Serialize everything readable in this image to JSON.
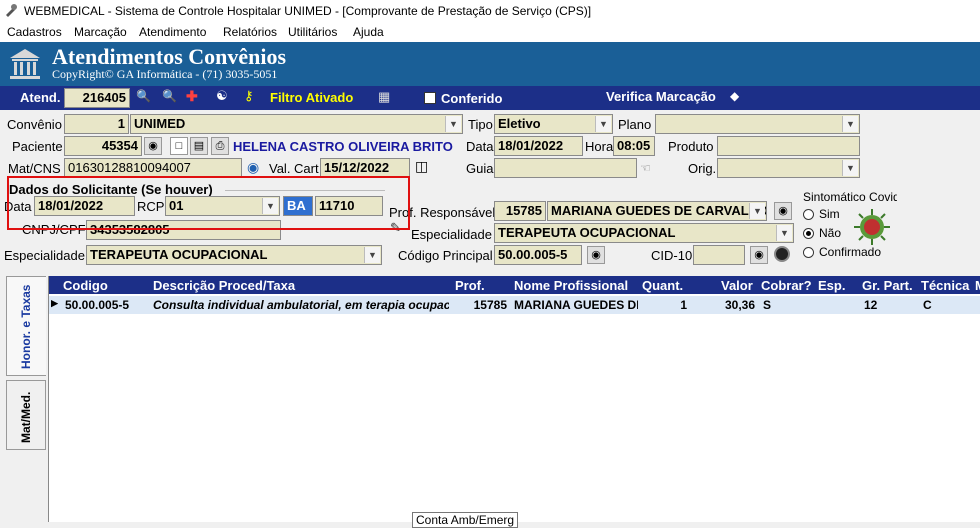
{
  "window": {
    "title": "WEBMEDICAL - Sistema de Controle Hospitalar UNIMED - [Comprovante de Prestação de Serviço  (CPS)]"
  },
  "menu": [
    "Cadastros",
    "Marcação",
    "Atendimento",
    "Relatórios",
    "Utilitários",
    "Ajuda"
  ],
  "banner": {
    "title": "Atendimentos Convênios",
    "subtitle": "CopyRight© GA Informática - (71) 3035-5051"
  },
  "toolbar": {
    "atend_label": "Atend.",
    "atend_value": "216405",
    "filtro_label": "Filtro Ativado",
    "conferido_label": "Conferido",
    "verifica_label": "Verifica Marcação"
  },
  "form": {
    "convenio_label": "Convênio",
    "convenio_code": "1",
    "convenio_name": "UNIMED",
    "tipo_label": "Tipo",
    "tipo_value": "Eletivo",
    "plano_label": "Plano",
    "plano_value": "",
    "paciente_label": "Paciente",
    "paciente_code": "45354",
    "paciente_name": "HELENA CASTRO OLIVEIRA BRITO",
    "data_label": "Data",
    "data_value": "18/01/2022",
    "hora_label": "Hora",
    "hora_value": "08:05",
    "produto_label": "Produto",
    "produto_value": "",
    "matcns_label": "Mat/CNS",
    "matcns_value": "01630128810094007",
    "valcart_label": "Val. Cart",
    "valcart_value": "15/12/2022",
    "guia_label": "Guia",
    "guia_value": "",
    "orig_label": "Orig.",
    "orig_value": "",
    "solic_title": "Dados do Solicitante (Se houver)",
    "solic_data_label": "Data",
    "solic_data_value": "18/01/2022",
    "rcp_label": "RCP",
    "rcp_value": "01",
    "uf_value": "BA",
    "crm_value": "11710",
    "cnpj_label": "CNPJ/CPF",
    "cnpj_value": "34353582805",
    "prof_label": "Prof. Responsável",
    "prof_code": "15785",
    "prof_name": "MARIANA GUEDES DE CARVALHO",
    "esp_label": "Especialidade",
    "esp_value": "TERAPEUTA OCUPACIONAL",
    "esp2_label": "Especialidade",
    "esp2_value": "TERAPEUTA OCUPACIONAL",
    "codprinc_label": "Código Principal",
    "codprinc_value": "50.00.005-5",
    "cid_label": "CID-10",
    "cid_value": ""
  },
  "sintomatico": {
    "title": "Sintomático Covid",
    "options": [
      "Sim",
      "Não",
      "Confirmado"
    ],
    "selected": "Não"
  },
  "tabs": [
    "Honor. e Taxas",
    "Mat/Med."
  ],
  "grid": {
    "headers": [
      "Codigo",
      "Descrição Proced/Taxa",
      "Prof.",
      "Nome Profissional",
      "Quant.",
      "Valor",
      "Cobrar?",
      "Esp.",
      "Gr. Part.",
      "Técnica",
      "M"
    ],
    "rows": [
      [
        "50.00.005-5",
        "Consulta individual ambulatorial, em terapia ocupacional",
        "15785",
        "MARIANA GUEDES DE CARVALHO",
        "1",
        "30,36",
        "S",
        "",
        "12",
        "C",
        ""
      ]
    ]
  },
  "tooltip": "Conta Amb/Emerg",
  "colors": {
    "banner": "#1a5f97",
    "toolbar": "#1c2f88",
    "field": "#e8e6c8",
    "highlight": "#e01010"
  }
}
